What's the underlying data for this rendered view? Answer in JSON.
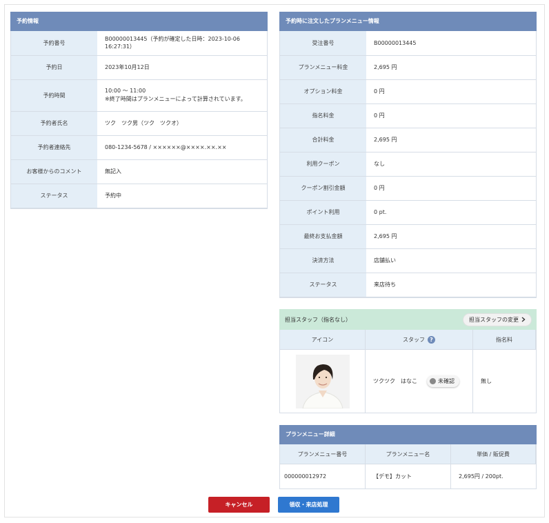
{
  "reservation": {
    "title": "予約情報",
    "rows": [
      {
        "label": "予約番号",
        "value": "B00000013445（予約が確定した日時：2023-10-06 16:27:31）"
      },
      {
        "label": "予約日",
        "value": "2023年10月12日"
      },
      {
        "label": "予約時間",
        "value": "10:00 ～ 11:00",
        "value2": "※終了時間はプランメニューによって計算されています。"
      },
      {
        "label": "予約者氏名",
        "value": "ツク　ツク男（ツク　ツクオ）"
      },
      {
        "label": "予約者連絡先",
        "value": "080-1234-5678 / ××××××@××××.××.××"
      },
      {
        "label": "お客様からのコメント",
        "value": "無記入"
      },
      {
        "label": "ステータス",
        "value": "予約中"
      }
    ]
  },
  "order": {
    "title": "予約時に注文したプランメニュー情報",
    "rows": [
      {
        "label": "受注番号",
        "value": "B00000013445"
      },
      {
        "label": "プランメニュー料金",
        "value": "2,695 円"
      },
      {
        "label": "オプション料金",
        "value": "0 円"
      },
      {
        "label": "指名料金",
        "value": "0 円"
      },
      {
        "label": "合計料金",
        "value": "2,695 円"
      },
      {
        "label": "利用クーポン",
        "value": "なし"
      },
      {
        "label": "クーポン割引金額",
        "value": "0 円"
      },
      {
        "label": "ポイント利用",
        "value": "0 pt."
      },
      {
        "label": "最終お支払金額",
        "value": "2,695 円"
      },
      {
        "label": "決済方法",
        "value": "店舗払い"
      },
      {
        "label": "ステータス",
        "value": "来店待ち"
      }
    ]
  },
  "staff": {
    "title": "担当スタッフ（指名なし）",
    "change_button": "担当スタッフの変更",
    "columns": [
      "アイコン",
      "スタッフ",
      "指名料"
    ],
    "name": "ツクツク　はなこ",
    "badge": "未確認",
    "fee": "無し",
    "help_icon": "question-icon",
    "chevron_icon": "chevron-right-icon"
  },
  "plan": {
    "title": "プランメニュー詳細",
    "columns": [
      "プランメニュー番号",
      "プランメニュー名",
      "単価 / 販促費"
    ],
    "row": {
      "number": "000000012972",
      "name": "【デモ】カット",
      "price": "2,695円 / 200pt."
    }
  },
  "actions": {
    "cancel": "キャンセル",
    "checkin": "領収・来店処理"
  },
  "colors": {
    "header_blue": "#6f8bb9",
    "label_bg": "#e4eef7",
    "staff_header": "#cbe9d9",
    "cancel": "#c62026",
    "checkin": "#2f78d0"
  }
}
